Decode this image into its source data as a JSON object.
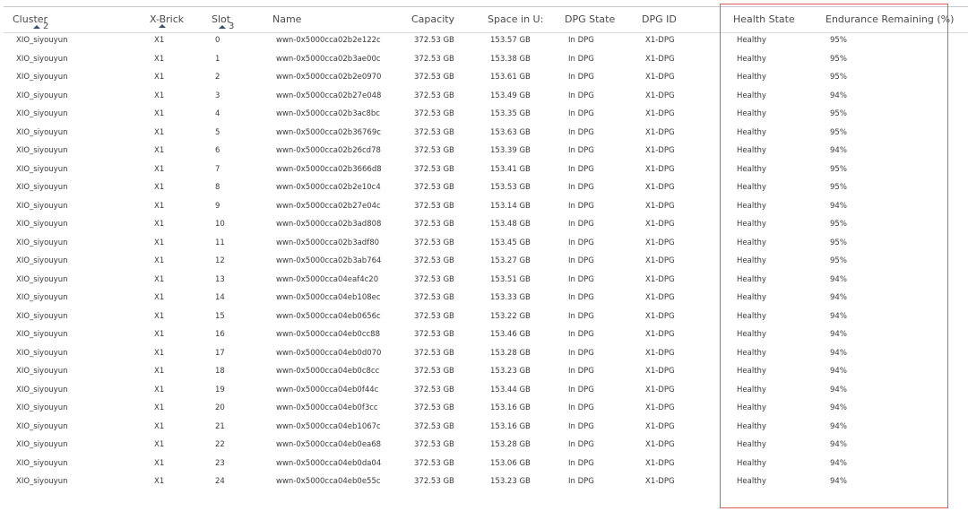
{
  "columns": {
    "cluster": "Cluster",
    "xbrick": "X-Brick",
    "slot": "Slot",
    "name": "Name",
    "capacity": "Capacity",
    "space": "Space in U:",
    "dpg_state": "DPG State",
    "dpg_id": "DPG ID",
    "health_state": "Health State",
    "endurance": "Endurance Remaining (%)"
  },
  "sort": {
    "cluster_order": "2",
    "slot_order": "3"
  },
  "colors": {
    "highlight_border": "#e05a5a",
    "sort_caret": "#3b5068"
  },
  "rows": [
    {
      "cluster": "XIO_siyouyun",
      "xbrick": "X1",
      "slot": "0",
      "name": "wwn-0x5000cca02b2e122c",
      "capacity": "372.53 GB",
      "space": "153.57 GB",
      "dpg_state": "In DPG",
      "dpg_id": "X1-DPG",
      "health": "Healthy",
      "endurance": "95%"
    },
    {
      "cluster": "XIO_siyouyun",
      "xbrick": "X1",
      "slot": "1",
      "name": "wwn-0x5000cca02b3ae00c",
      "capacity": "372.53 GB",
      "space": "153.38 GB",
      "dpg_state": "In DPG",
      "dpg_id": "X1-DPG",
      "health": "Healthy",
      "endurance": "95%"
    },
    {
      "cluster": "XIO_siyouyun",
      "xbrick": "X1",
      "slot": "2",
      "name": "wwn-0x5000cca02b2e0970",
      "capacity": "372.53 GB",
      "space": "153.61 GB",
      "dpg_state": "In DPG",
      "dpg_id": "X1-DPG",
      "health": "Healthy",
      "endurance": "95%"
    },
    {
      "cluster": "XIO_siyouyun",
      "xbrick": "X1",
      "slot": "3",
      "name": "wwn-0x5000cca02b27e048",
      "capacity": "372.53 GB",
      "space": "153.49 GB",
      "dpg_state": "In DPG",
      "dpg_id": "X1-DPG",
      "health": "Healthy",
      "endurance": "94%"
    },
    {
      "cluster": "XIO_siyouyun",
      "xbrick": "X1",
      "slot": "4",
      "name": "wwn-0x5000cca02b3ac8bc",
      "capacity": "372.53 GB",
      "space": "153.35 GB",
      "dpg_state": "In DPG",
      "dpg_id": "X1-DPG",
      "health": "Healthy",
      "endurance": "95%"
    },
    {
      "cluster": "XIO_siyouyun",
      "xbrick": "X1",
      "slot": "5",
      "name": "wwn-0x5000cca02b36769c",
      "capacity": "372.53 GB",
      "space": "153.63 GB",
      "dpg_state": "In DPG",
      "dpg_id": "X1-DPG",
      "health": "Healthy",
      "endurance": "95%"
    },
    {
      "cluster": "XIO_siyouyun",
      "xbrick": "X1",
      "slot": "6",
      "name": "wwn-0x5000cca02b26cd78",
      "capacity": "372.53 GB",
      "space": "153.39 GB",
      "dpg_state": "In DPG",
      "dpg_id": "X1-DPG",
      "health": "Healthy",
      "endurance": "94%"
    },
    {
      "cluster": "XIO_siyouyun",
      "xbrick": "X1",
      "slot": "7",
      "name": "wwn-0x5000cca02b3666d8",
      "capacity": "372.53 GB",
      "space": "153.41 GB",
      "dpg_state": "In DPG",
      "dpg_id": "X1-DPG",
      "health": "Healthy",
      "endurance": "95%"
    },
    {
      "cluster": "XIO_siyouyun",
      "xbrick": "X1",
      "slot": "8",
      "name": "wwn-0x5000cca02b2e10c4",
      "capacity": "372.53 GB",
      "space": "153.53 GB",
      "dpg_state": "In DPG",
      "dpg_id": "X1-DPG",
      "health": "Healthy",
      "endurance": "95%"
    },
    {
      "cluster": "XIO_siyouyun",
      "xbrick": "X1",
      "slot": "9",
      "name": "wwn-0x5000cca02b27e04c",
      "capacity": "372.53 GB",
      "space": "153.14 GB",
      "dpg_state": "In DPG",
      "dpg_id": "X1-DPG",
      "health": "Healthy",
      "endurance": "94%"
    },
    {
      "cluster": "XIO_siyouyun",
      "xbrick": "X1",
      "slot": "10",
      "name": "wwn-0x5000cca02b3ad808",
      "capacity": "372.53 GB",
      "space": "153.48 GB",
      "dpg_state": "In DPG",
      "dpg_id": "X1-DPG",
      "health": "Healthy",
      "endurance": "95%"
    },
    {
      "cluster": "XIO_siyouyun",
      "xbrick": "X1",
      "slot": "11",
      "name": "wwn-0x5000cca02b3adf80",
      "capacity": "372.53 GB",
      "space": "153.45 GB",
      "dpg_state": "In DPG",
      "dpg_id": "X1-DPG",
      "health": "Healthy",
      "endurance": "95%"
    },
    {
      "cluster": "XIO_siyouyun",
      "xbrick": "X1",
      "slot": "12",
      "name": "wwn-0x5000cca02b3ab764",
      "capacity": "372.53 GB",
      "space": "153.27 GB",
      "dpg_state": "In DPG",
      "dpg_id": "X1-DPG",
      "health": "Healthy",
      "endurance": "95%"
    },
    {
      "cluster": "XIO_siyouyun",
      "xbrick": "X1",
      "slot": "13",
      "name": "wwn-0x5000cca04eaf4c20",
      "capacity": "372.53 GB",
      "space": "153.51 GB",
      "dpg_state": "In DPG",
      "dpg_id": "X1-DPG",
      "health": "Healthy",
      "endurance": "94%"
    },
    {
      "cluster": "XIO_siyouyun",
      "xbrick": "X1",
      "slot": "14",
      "name": "wwn-0x5000cca04eb108ec",
      "capacity": "372.53 GB",
      "space": "153.33 GB",
      "dpg_state": "In DPG",
      "dpg_id": "X1-DPG",
      "health": "Healthy",
      "endurance": "94%"
    },
    {
      "cluster": "XIO_siyouyun",
      "xbrick": "X1",
      "slot": "15",
      "name": "wwn-0x5000cca04eb0656c",
      "capacity": "372.53 GB",
      "space": "153.22 GB",
      "dpg_state": "In DPG",
      "dpg_id": "X1-DPG",
      "health": "Healthy",
      "endurance": "94%"
    },
    {
      "cluster": "XIO_siyouyun",
      "xbrick": "X1",
      "slot": "16",
      "name": "wwn-0x5000cca04eb0cc88",
      "capacity": "372.53 GB",
      "space": "153.46 GB",
      "dpg_state": "In DPG",
      "dpg_id": "X1-DPG",
      "health": "Healthy",
      "endurance": "94%"
    },
    {
      "cluster": "XIO_siyouyun",
      "xbrick": "X1",
      "slot": "17",
      "name": "wwn-0x5000cca04eb0d070",
      "capacity": "372.53 GB",
      "space": "153.28 GB",
      "dpg_state": "In DPG",
      "dpg_id": "X1-DPG",
      "health": "Healthy",
      "endurance": "94%"
    },
    {
      "cluster": "XIO_siyouyun",
      "xbrick": "X1",
      "slot": "18",
      "name": "wwn-0x5000cca04eb0c8cc",
      "capacity": "372.53 GB",
      "space": "153.23 GB",
      "dpg_state": "In DPG",
      "dpg_id": "X1-DPG",
      "health": "Healthy",
      "endurance": "94%"
    },
    {
      "cluster": "XIO_siyouyun",
      "xbrick": "X1",
      "slot": "19",
      "name": "wwn-0x5000cca04eb0f44c",
      "capacity": "372.53 GB",
      "space": "153.44 GB",
      "dpg_state": "In DPG",
      "dpg_id": "X1-DPG",
      "health": "Healthy",
      "endurance": "94%"
    },
    {
      "cluster": "XIO_siyouyun",
      "xbrick": "X1",
      "slot": "20",
      "name": "wwn-0x5000cca04eb0f3cc",
      "capacity": "372.53 GB",
      "space": "153.16 GB",
      "dpg_state": "In DPG",
      "dpg_id": "X1-DPG",
      "health": "Healthy",
      "endurance": "94%"
    },
    {
      "cluster": "XIO_siyouyun",
      "xbrick": "X1",
      "slot": "21",
      "name": "wwn-0x5000cca04eb1067c",
      "capacity": "372.53 GB",
      "space": "153.16 GB",
      "dpg_state": "In DPG",
      "dpg_id": "X1-DPG",
      "health": "Healthy",
      "endurance": "94%"
    },
    {
      "cluster": "XIO_siyouyun",
      "xbrick": "X1",
      "slot": "22",
      "name": "wwn-0x5000cca04eb0ea68",
      "capacity": "372.53 GB",
      "space": "153.28 GB",
      "dpg_state": "In DPG",
      "dpg_id": "X1-DPG",
      "health": "Healthy",
      "endurance": "94%"
    },
    {
      "cluster": "XIO_siyouyun",
      "xbrick": "X1",
      "slot": "23",
      "name": "wwn-0x5000cca04eb0da04",
      "capacity": "372.53 GB",
      "space": "153.06 GB",
      "dpg_state": "In DPG",
      "dpg_id": "X1-DPG",
      "health": "Healthy",
      "endurance": "94%"
    },
    {
      "cluster": "XIO_siyouyun",
      "xbrick": "X1",
      "slot": "24",
      "name": "wwn-0x5000cca04eb0e55c",
      "capacity": "372.53 GB",
      "space": "153.23 GB",
      "dpg_state": "In DPG",
      "dpg_id": "X1-DPG",
      "health": "Healthy",
      "endurance": "94%"
    }
  ]
}
